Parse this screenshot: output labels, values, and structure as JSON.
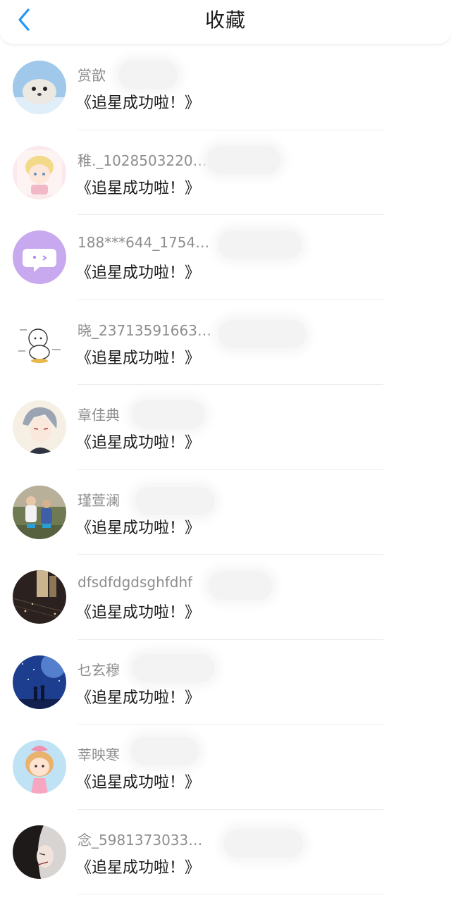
{
  "header": {
    "title": "收藏",
    "back_icon": "chevron-left-icon",
    "accent": "#2196f3"
  },
  "favorites": [
    {
      "username": "赏歆",
      "message": "《追星成功啦！》",
      "avatar": "seal-avatar"
    },
    {
      "username": "稚._1028503220…",
      "message": "《追星成功啦！》",
      "avatar": "anime-boy-avatar"
    },
    {
      "username": "188***644_1754…",
      "message": "《追星成功啦！》",
      "avatar": "chat-bubble-avatar"
    },
    {
      "username": "晓_23713591663…",
      "message": "《追星成功啦！》",
      "avatar": "doodle-avatar"
    },
    {
      "username": "章佳典",
      "message": "《追星成功啦！》",
      "avatar": "anime-man-avatar"
    },
    {
      "username": "瑾萱澜",
      "message": "《追星成功啦！》",
      "avatar": "kids-photo-avatar"
    },
    {
      "username": "dfsdfdgdsghfdhf",
      "message": "《追星成功啦！》",
      "avatar": "dark-room-avatar"
    },
    {
      "username": "乜玄穆",
      "message": "《追星成功啦！》",
      "avatar": "night-sky-avatar"
    },
    {
      "username": "莘映寒",
      "message": "《追星成功啦！》",
      "avatar": "cartoon-girl-avatar"
    },
    {
      "username": "念_5981373033…",
      "message": "《追星成功啦！》",
      "avatar": "dark-portrait-avatar"
    }
  ]
}
